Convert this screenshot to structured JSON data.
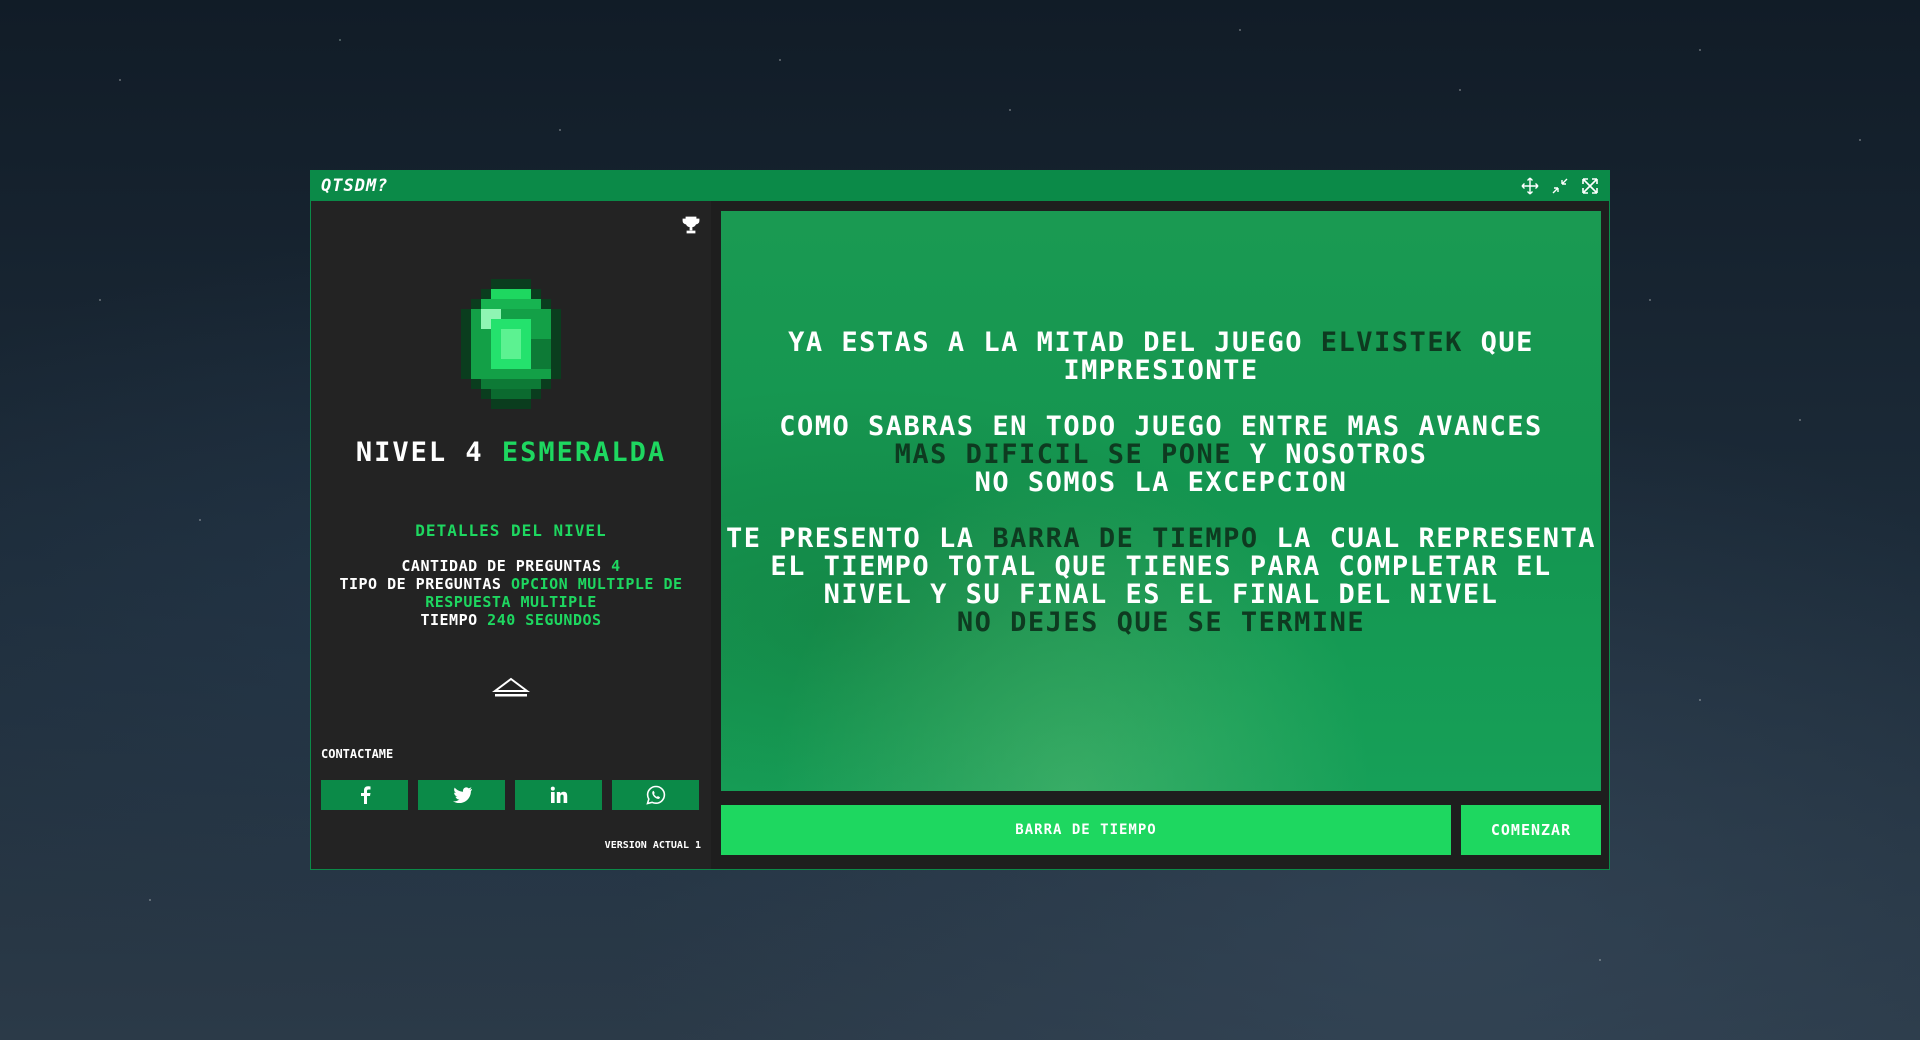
{
  "app": {
    "title": "QTSDM?"
  },
  "window_controls": [
    {
      "name": "move",
      "icon": "move-icon"
    },
    {
      "name": "minimize",
      "icon": "compress-icon"
    },
    {
      "name": "maximize",
      "icon": "expand-icon"
    }
  ],
  "sidebar": {
    "level_prefix": "NIVEL 4",
    "level_name": "ESMERALDA",
    "details_heading": "DETALLES DEL NIVEL",
    "details": {
      "questions_label": "CANTIDAD DE PREGUNTAS",
      "questions_value": "4",
      "type_label": "TIPO DE PREGUNTAS",
      "type_value": "OPCION MULTIPLE DE RESPUESTA MULTIPLE",
      "time_label": "TIEMPO",
      "time_value": "240 SEGUNDOS"
    },
    "contact_label": "CONTACTAME",
    "socials": [
      {
        "name": "facebook",
        "icon": "facebook-icon"
      },
      {
        "name": "twitter",
        "icon": "twitter-icon"
      },
      {
        "name": "linkedin",
        "icon": "linkedin-icon"
      },
      {
        "name": "whatsapp",
        "icon": "whatsapp-icon"
      }
    ],
    "version": "VERSION ACTUAL 1"
  },
  "main": {
    "line1_a": "YA ESTAS A LA MITAD DEL JUEGO",
    "line1_name": "ELVISTEK",
    "line1_b": "QUE IMPRESIONTE",
    "line2_a": "COMO SABRAS EN TODO JUEGO ENTRE MAS AVANCES",
    "line2_highlight": "MAS DIFICIL SE PONE",
    "line2_b": "Y NOSOTROS",
    "line2_c": "NO SOMOS LA EXCEPCION",
    "line3_a": "TE PRESENTO LA",
    "line3_highlight": "BARRA DE TIEMPO",
    "line3_b": "LA CUAL REPRESENTA EL TIEMPO TOTAL QUE TIENES PARA COMPLETAR EL NIVEL Y SU FINAL ES EL FINAL DEL NIVEL",
    "line3_c": "NO DEJES QUE SE TERMINE"
  },
  "time_bar": {
    "label": "BARRA DE TIEMPO"
  },
  "start_button": {
    "label": "COMENZAR"
  },
  "colors": {
    "accent": "#1ed760",
    "window_green": "#0b8a48",
    "panel_green": "#149550",
    "dark_text": "#0e3a20",
    "sidebar_bg": "#232323"
  }
}
